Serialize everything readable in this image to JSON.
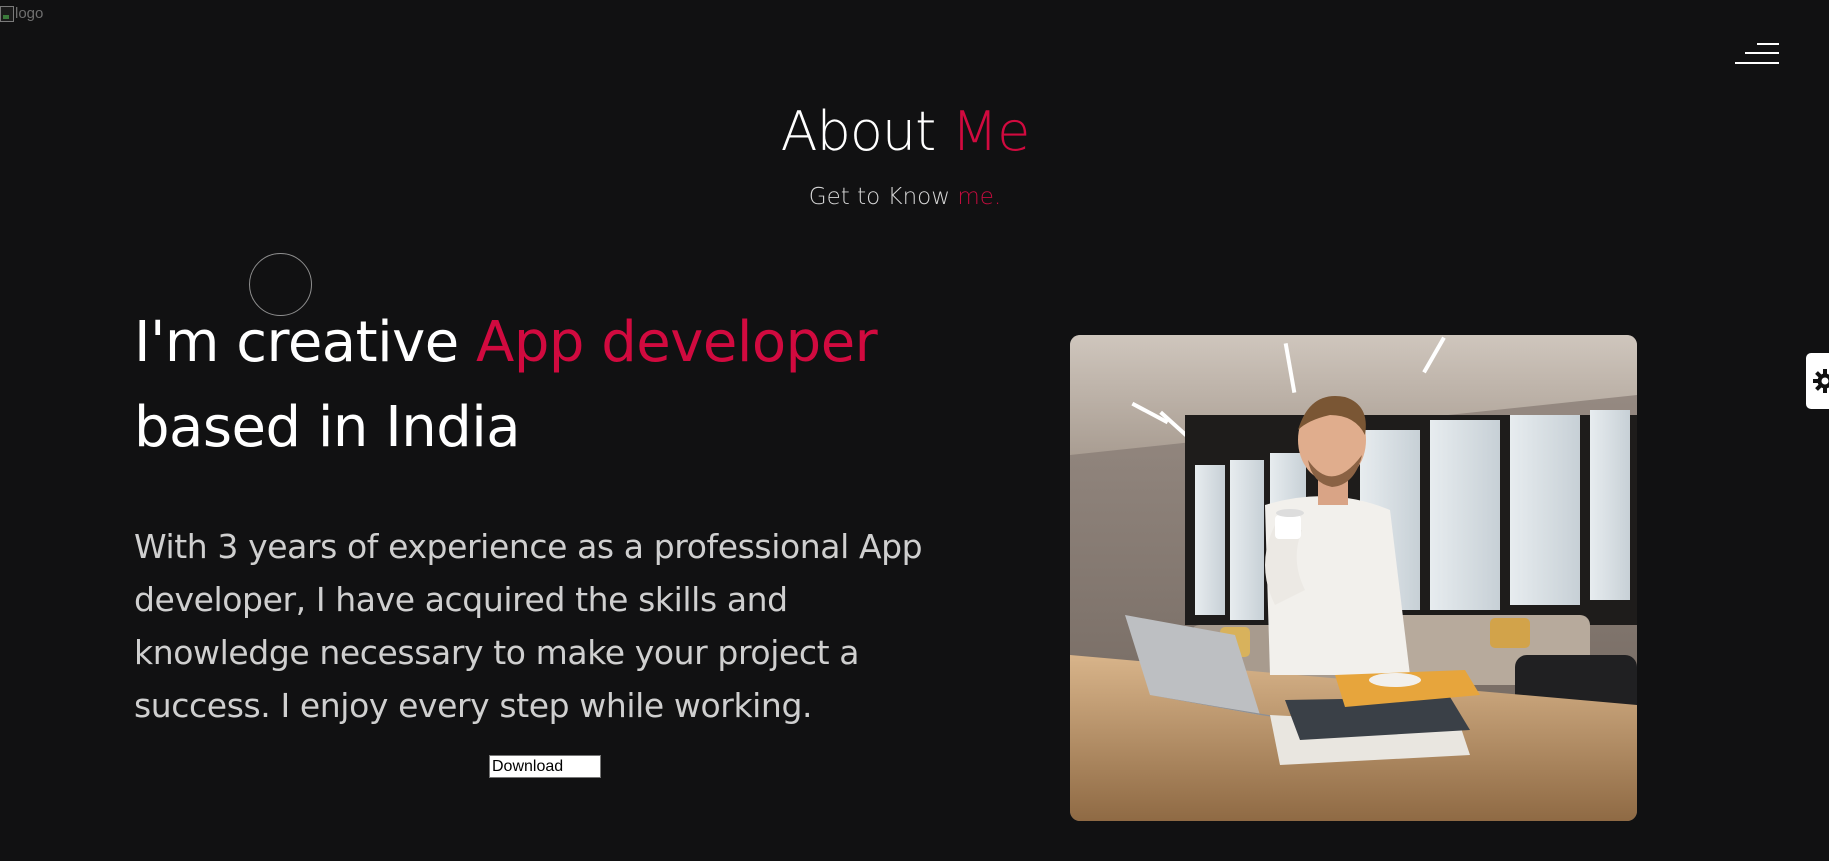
{
  "header": {
    "logo_alt": "logo",
    "menu_icon": "hamburger-menu-icon"
  },
  "section": {
    "title_main": "About",
    "title_accent": "Me",
    "subtitle_main": "Get to Know",
    "subtitle_accent": "me."
  },
  "intro": {
    "headline_part1": "I'm creative",
    "headline_accent": "App developer",
    "headline_part2": "based in India",
    "paragraph": "With 3 years of experience as a professional App developer, I have acquired the skills and knowledge necessary to make your project a success. I enjoy every step while working.",
    "download_label": "Download"
  },
  "photo": {
    "alt": "Smiling man drinking coffee at laptop in office"
  },
  "settings": {
    "icon": "gear-icon"
  },
  "colors": {
    "background": "#111112",
    "accent": "#d10a3f",
    "text": "#ffffff",
    "muted_text": "#cfcfcf"
  }
}
